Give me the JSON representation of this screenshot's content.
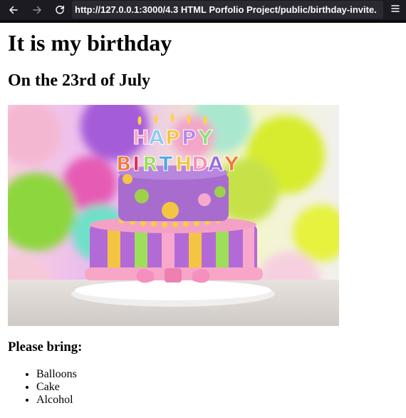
{
  "browser": {
    "url": "http://127.0.0.1:3000/4.3 HTML Porfolio Project/public/birthday-invite.",
    "icons": [
      "back-arrow-icon",
      "forward-arrow-icon",
      "reload-icon",
      "hamburger-menu-icon"
    ]
  },
  "page": {
    "title": "It is my birthday",
    "subtitle": "On the 23rd of July",
    "bring_heading": "Please bring:",
    "bring_items": [
      "Balloons",
      "Cake",
      "Alcohol"
    ]
  },
  "image": {
    "depicts": "birthday-cake-photo",
    "topper_text": "HAPPY BIRTHDAY"
  }
}
